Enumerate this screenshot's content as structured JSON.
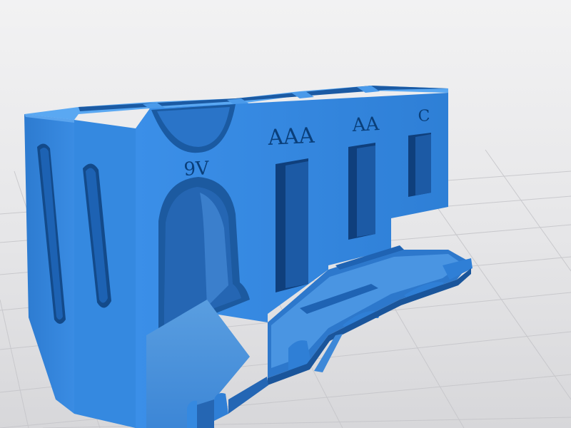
{
  "scene": {
    "labels": {
      "nine_v": "9V",
      "aaa": "AAA",
      "aa": "AA",
      "c": "C"
    },
    "colors": {
      "background": "#e9e9ea",
      "grid": "#c9c9cd",
      "body_main": "#2f7fd6",
      "body_light": "#3d92ea",
      "body_shadow": "#1f5fa8",
      "body_deep": "#174a86",
      "slot_dark": "#0e3d75"
    }
  }
}
